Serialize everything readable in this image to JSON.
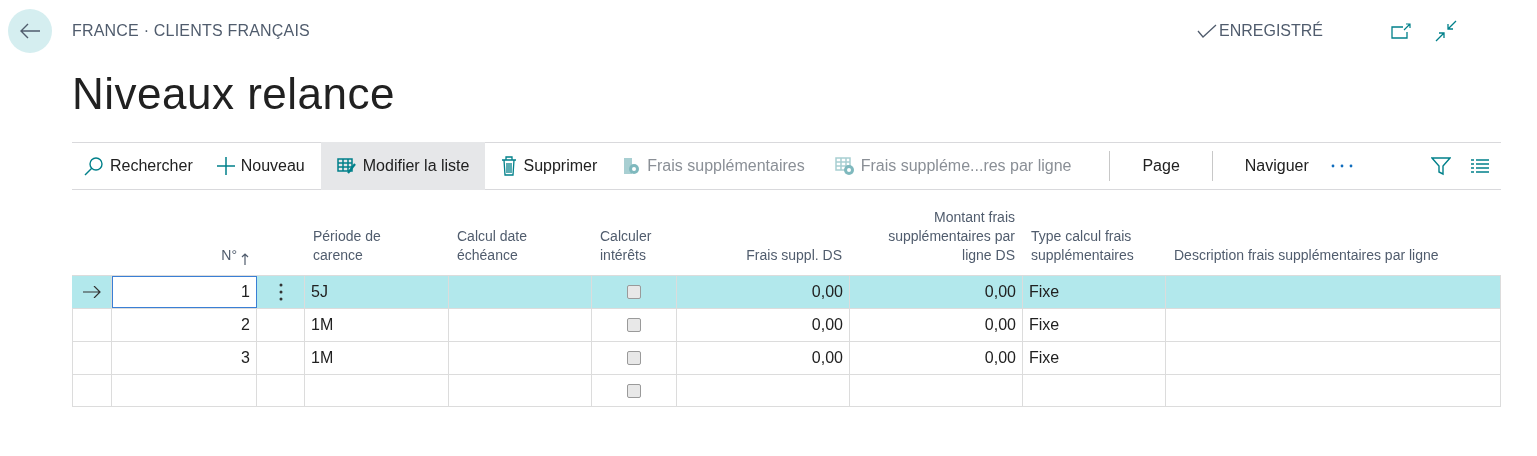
{
  "breadcrumb": "FRANCE · CLIENTS FRANÇAIS",
  "save_status": "ENREGISTRÉ",
  "title": "Niveaux relance",
  "actions": [
    {
      "label": "Rechercher",
      "kind": "search",
      "selected": false,
      "disabled": false
    },
    {
      "label": "Nouveau",
      "kind": "new",
      "selected": false,
      "disabled": false
    },
    {
      "label": "Modifier la liste",
      "kind": "edit-list",
      "selected": true,
      "disabled": false
    },
    {
      "label": "Supprimer",
      "kind": "delete",
      "selected": false,
      "disabled": false
    },
    {
      "label": "Frais supplémentaires",
      "kind": "charges",
      "selected": false,
      "disabled": true
    },
    {
      "label": "Frais suppléme...res par ligne",
      "kind": "line-charges",
      "selected": false,
      "disabled": true
    },
    {
      "label": "Page",
      "kind": "menu",
      "selected": false,
      "disabled": false
    },
    {
      "label": "Naviguer",
      "kind": "menu",
      "selected": false,
      "disabled": false
    }
  ],
  "columns": [
    {
      "label": "N°",
      "kind": "number",
      "sorted": true
    },
    {
      "label": "Période de carence",
      "kind": "text"
    },
    {
      "label": "Calcul date échéance",
      "kind": "text"
    },
    {
      "label": "Calculer intérêts",
      "kind": "check"
    },
    {
      "label": "Frais suppl. DS",
      "kind": "number"
    },
    {
      "label": "Montant frais supplémentaires par ligne DS",
      "kind": "number"
    },
    {
      "label": "Type calcul frais supplémentaires",
      "kind": "text"
    },
    {
      "label": "Description frais supplémentaires par ligne",
      "kind": "text"
    }
  ],
  "rows": [
    {
      "selected": true,
      "focused": true,
      "no": "1",
      "grace": "5J",
      "interest": false,
      "fee": "0,00",
      "line_fee": "0,00",
      "type": "Fixe"
    },
    {
      "selected": false,
      "focused": false,
      "no": "2",
      "grace": "1M",
      "interest": false,
      "fee": "0,00",
      "line_fee": "0,00",
      "type": "Fixe"
    },
    {
      "selected": false,
      "focused": false,
      "no": "3",
      "grace": "1M",
      "interest": false,
      "fee": "0,00",
      "line_fee": "0,00",
      "type": "Fixe"
    },
    {
      "selected": false,
      "focused": false,
      "interest": false
    }
  ]
}
